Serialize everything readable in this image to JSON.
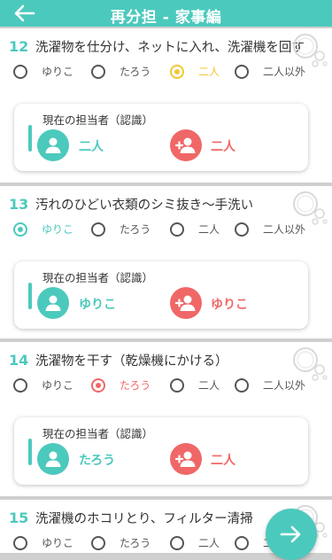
{
  "header": {
    "title": "再分担 - 家事編"
  },
  "icons": {
    "back": "arrow-left-icon",
    "next": "arrow-right-icon",
    "person": "person-icon",
    "add_person": "person-add-icon",
    "bubbles": "bubbles-icon"
  },
  "colors": {
    "teal": "#4cc9bd",
    "red": "#f06767",
    "yellow": "#f3c633"
  },
  "card_title": "現在の担当者（認識）",
  "questions": [
    {
      "number": "12",
      "text": "洗濯物を仕分け、ネットに入れ、洗濯機を回す",
      "options": [
        "ゆりこ",
        "たろう",
        "二人",
        "二人以外"
      ],
      "selected": "二人",
      "assignee_left": "二人",
      "assignee_right": "二人"
    },
    {
      "number": "13",
      "text": "汚れのひどい衣類のシミ抜き～手洗い",
      "options": [
        "ゆりこ",
        "たろう",
        "二人",
        "二人以外"
      ],
      "selected": "ゆりこ",
      "assignee_left": "ゆりこ",
      "assignee_right": "ゆりこ"
    },
    {
      "number": "14",
      "text": "洗濯物を干す（乾燥機にかける）",
      "options": [
        "ゆりこ",
        "たろう",
        "二人",
        "二人以外"
      ],
      "selected": "たろう",
      "assignee_left": "たろう",
      "assignee_right": "二人"
    },
    {
      "number": "15",
      "text": "洗濯機のホコリとり、フィルター清掃",
      "options": [
        "ゆりこ",
        "たろう",
        "二人",
        "二人以外"
      ],
      "selected": ""
    }
  ]
}
